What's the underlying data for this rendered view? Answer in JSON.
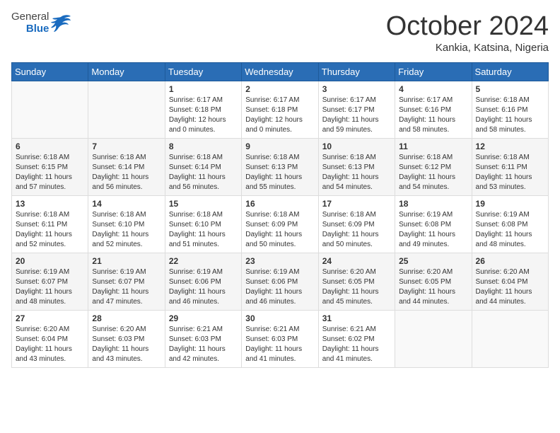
{
  "logo": {
    "general": "General",
    "blue": "Blue"
  },
  "header": {
    "month": "October 2024",
    "location": "Kankia, Katsina, Nigeria"
  },
  "weekdays": [
    "Sunday",
    "Monday",
    "Tuesday",
    "Wednesday",
    "Thursday",
    "Friday",
    "Saturday"
  ],
  "weeks": [
    [
      {
        "day": "",
        "content": ""
      },
      {
        "day": "",
        "content": ""
      },
      {
        "day": "1",
        "content": "Sunrise: 6:17 AM\nSunset: 6:18 PM\nDaylight: 12 hours\nand 0 minutes."
      },
      {
        "day": "2",
        "content": "Sunrise: 6:17 AM\nSunset: 6:18 PM\nDaylight: 12 hours\nand 0 minutes."
      },
      {
        "day": "3",
        "content": "Sunrise: 6:17 AM\nSunset: 6:17 PM\nDaylight: 11 hours\nand 59 minutes."
      },
      {
        "day": "4",
        "content": "Sunrise: 6:17 AM\nSunset: 6:16 PM\nDaylight: 11 hours\nand 58 minutes."
      },
      {
        "day": "5",
        "content": "Sunrise: 6:18 AM\nSunset: 6:16 PM\nDaylight: 11 hours\nand 58 minutes."
      }
    ],
    [
      {
        "day": "6",
        "content": "Sunrise: 6:18 AM\nSunset: 6:15 PM\nDaylight: 11 hours\nand 57 minutes."
      },
      {
        "day": "7",
        "content": "Sunrise: 6:18 AM\nSunset: 6:14 PM\nDaylight: 11 hours\nand 56 minutes."
      },
      {
        "day": "8",
        "content": "Sunrise: 6:18 AM\nSunset: 6:14 PM\nDaylight: 11 hours\nand 56 minutes."
      },
      {
        "day": "9",
        "content": "Sunrise: 6:18 AM\nSunset: 6:13 PM\nDaylight: 11 hours\nand 55 minutes."
      },
      {
        "day": "10",
        "content": "Sunrise: 6:18 AM\nSunset: 6:13 PM\nDaylight: 11 hours\nand 54 minutes."
      },
      {
        "day": "11",
        "content": "Sunrise: 6:18 AM\nSunset: 6:12 PM\nDaylight: 11 hours\nand 54 minutes."
      },
      {
        "day": "12",
        "content": "Sunrise: 6:18 AM\nSunset: 6:11 PM\nDaylight: 11 hours\nand 53 minutes."
      }
    ],
    [
      {
        "day": "13",
        "content": "Sunrise: 6:18 AM\nSunset: 6:11 PM\nDaylight: 11 hours\nand 52 minutes."
      },
      {
        "day": "14",
        "content": "Sunrise: 6:18 AM\nSunset: 6:10 PM\nDaylight: 11 hours\nand 52 minutes."
      },
      {
        "day": "15",
        "content": "Sunrise: 6:18 AM\nSunset: 6:10 PM\nDaylight: 11 hours\nand 51 minutes."
      },
      {
        "day": "16",
        "content": "Sunrise: 6:18 AM\nSunset: 6:09 PM\nDaylight: 11 hours\nand 50 minutes."
      },
      {
        "day": "17",
        "content": "Sunrise: 6:18 AM\nSunset: 6:09 PM\nDaylight: 11 hours\nand 50 minutes."
      },
      {
        "day": "18",
        "content": "Sunrise: 6:19 AM\nSunset: 6:08 PM\nDaylight: 11 hours\nand 49 minutes."
      },
      {
        "day": "19",
        "content": "Sunrise: 6:19 AM\nSunset: 6:08 PM\nDaylight: 11 hours\nand 48 minutes."
      }
    ],
    [
      {
        "day": "20",
        "content": "Sunrise: 6:19 AM\nSunset: 6:07 PM\nDaylight: 11 hours\nand 48 minutes."
      },
      {
        "day": "21",
        "content": "Sunrise: 6:19 AM\nSunset: 6:07 PM\nDaylight: 11 hours\nand 47 minutes."
      },
      {
        "day": "22",
        "content": "Sunrise: 6:19 AM\nSunset: 6:06 PM\nDaylight: 11 hours\nand 46 minutes."
      },
      {
        "day": "23",
        "content": "Sunrise: 6:19 AM\nSunset: 6:06 PM\nDaylight: 11 hours\nand 46 minutes."
      },
      {
        "day": "24",
        "content": "Sunrise: 6:20 AM\nSunset: 6:05 PM\nDaylight: 11 hours\nand 45 minutes."
      },
      {
        "day": "25",
        "content": "Sunrise: 6:20 AM\nSunset: 6:05 PM\nDaylight: 11 hours\nand 44 minutes."
      },
      {
        "day": "26",
        "content": "Sunrise: 6:20 AM\nSunset: 6:04 PM\nDaylight: 11 hours\nand 44 minutes."
      }
    ],
    [
      {
        "day": "27",
        "content": "Sunrise: 6:20 AM\nSunset: 6:04 PM\nDaylight: 11 hours\nand 43 minutes."
      },
      {
        "day": "28",
        "content": "Sunrise: 6:20 AM\nSunset: 6:03 PM\nDaylight: 11 hours\nand 43 minutes."
      },
      {
        "day": "29",
        "content": "Sunrise: 6:21 AM\nSunset: 6:03 PM\nDaylight: 11 hours\nand 42 minutes."
      },
      {
        "day": "30",
        "content": "Sunrise: 6:21 AM\nSunset: 6:03 PM\nDaylight: 11 hours\nand 41 minutes."
      },
      {
        "day": "31",
        "content": "Sunrise: 6:21 AM\nSunset: 6:02 PM\nDaylight: 11 hours\nand 41 minutes."
      },
      {
        "day": "",
        "content": ""
      },
      {
        "day": "",
        "content": ""
      }
    ]
  ]
}
